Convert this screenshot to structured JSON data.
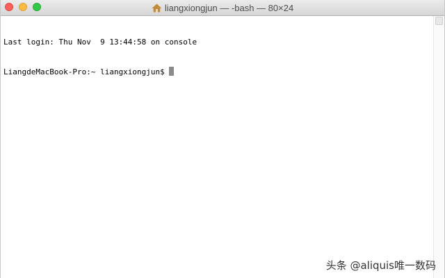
{
  "window": {
    "title": "liangxiongjun — -bash — 80×24"
  },
  "terminal": {
    "lines": [
      "Last login: Thu Nov  9 13:44:58 on console",
      "LiangdeMacBook-Pro:~ liangxiongjun$ "
    ]
  },
  "watermark": {
    "text": "头条 @aliquis唯一数码"
  },
  "colors": {
    "close": "#fc605b",
    "minimize": "#fdbc40",
    "zoom": "#34c84a",
    "home_icon": "#c38a3a"
  },
  "icons": {
    "title_icon": "home-icon"
  }
}
